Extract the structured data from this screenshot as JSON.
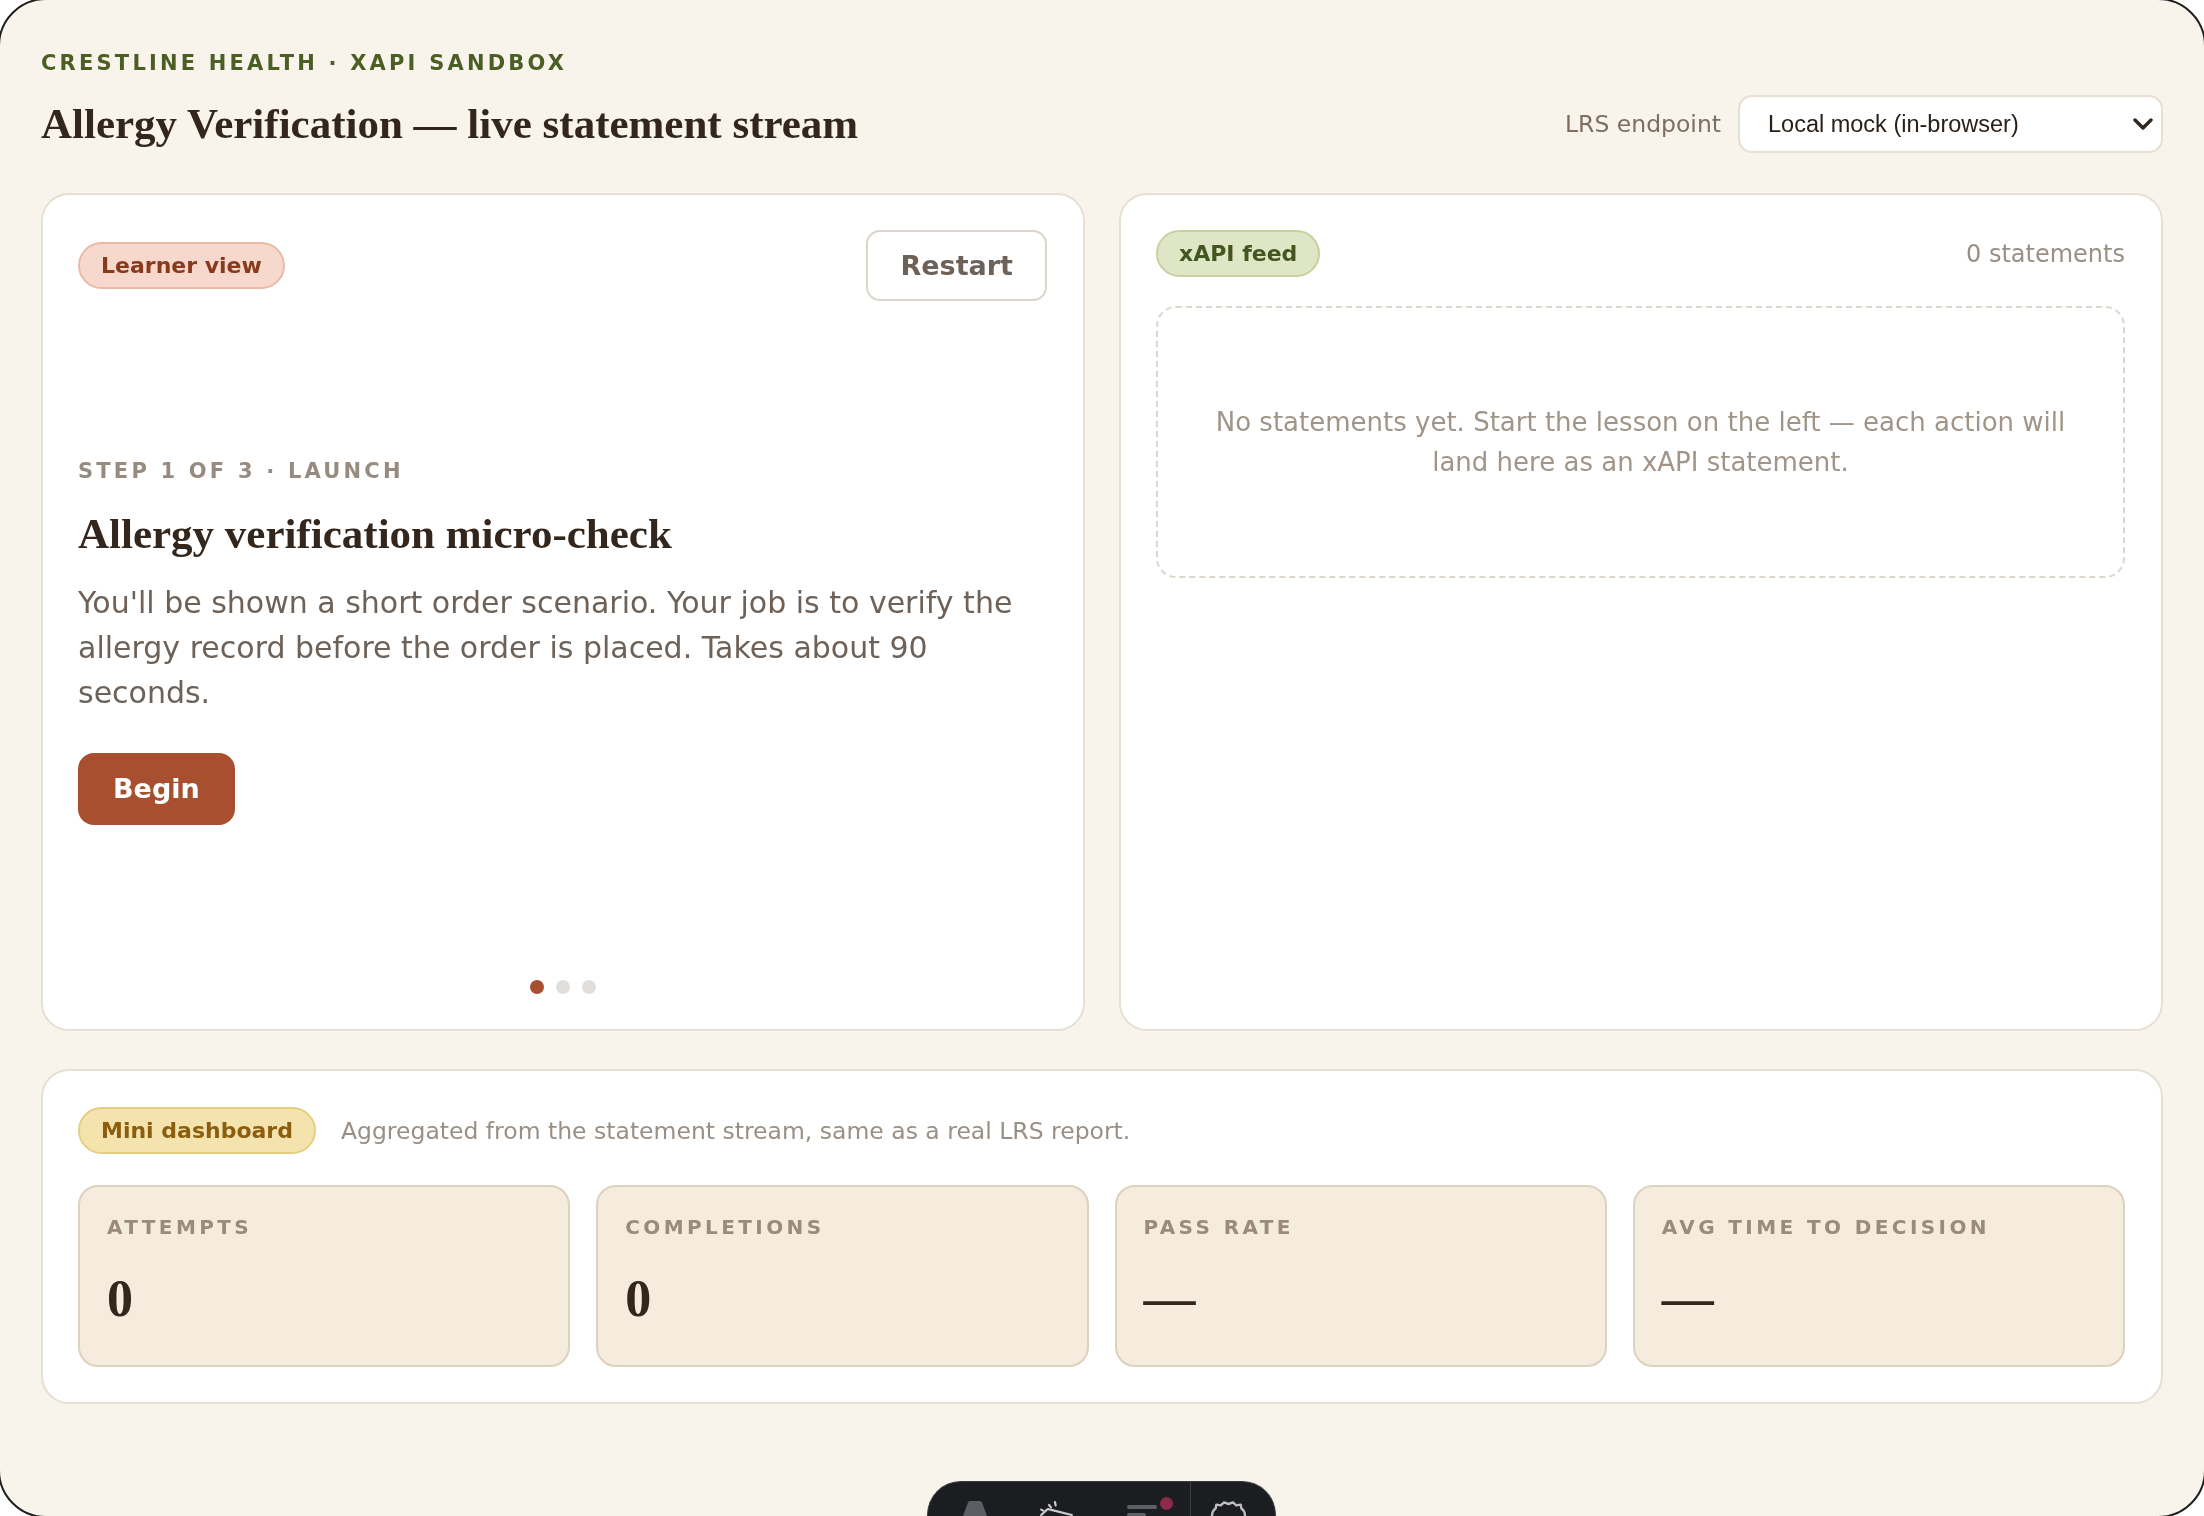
{
  "header": {
    "eyebrow": "CRESTLINE HEALTH · XAPI SANDBOX",
    "title": "Allergy Verification — live statement stream",
    "endpoint": {
      "label": "LRS endpoint",
      "value": "Local mock (in-browser)"
    }
  },
  "learner_panel": {
    "badge": "Learner view",
    "restart_button": "Restart",
    "step_label": "STEP 1 OF 3 · LAUNCH",
    "heading": "Allergy verification micro-check",
    "description": "You'll be shown a short order scenario. Your job is to verify the allergy record before the order is placed. Takes about 90 seconds.",
    "begin_button": "Begin",
    "steps": [
      {
        "selected": true
      },
      {
        "selected": false
      },
      {
        "selected": false
      }
    ]
  },
  "feed_panel": {
    "badge": "xAPI feed",
    "count": "0 statements",
    "empty_message": "No statements yet. Start the lesson on the left — each action will land here as an xAPI statement."
  },
  "dashboard": {
    "badge": "Mini dashboard",
    "description": "Aggregated from the statement stream, same as a real LRS report.",
    "stats": [
      {
        "label": "ATTEMPTS",
        "value": "0"
      },
      {
        "label": "COMPLETIONS",
        "value": "0"
      },
      {
        "label": "PASS RATE",
        "value": "—"
      },
      {
        "label": "AVG TIME TO DECISION",
        "value": "—"
      }
    ]
  },
  "dev_toolbar": {
    "items": [
      {
        "kind": "logo",
        "alert": false
      },
      {
        "kind": "inspect",
        "alert": false
      },
      {
        "kind": "audit",
        "alert": true
      },
      {
        "kind": "settings",
        "alert": false
      }
    ]
  }
}
